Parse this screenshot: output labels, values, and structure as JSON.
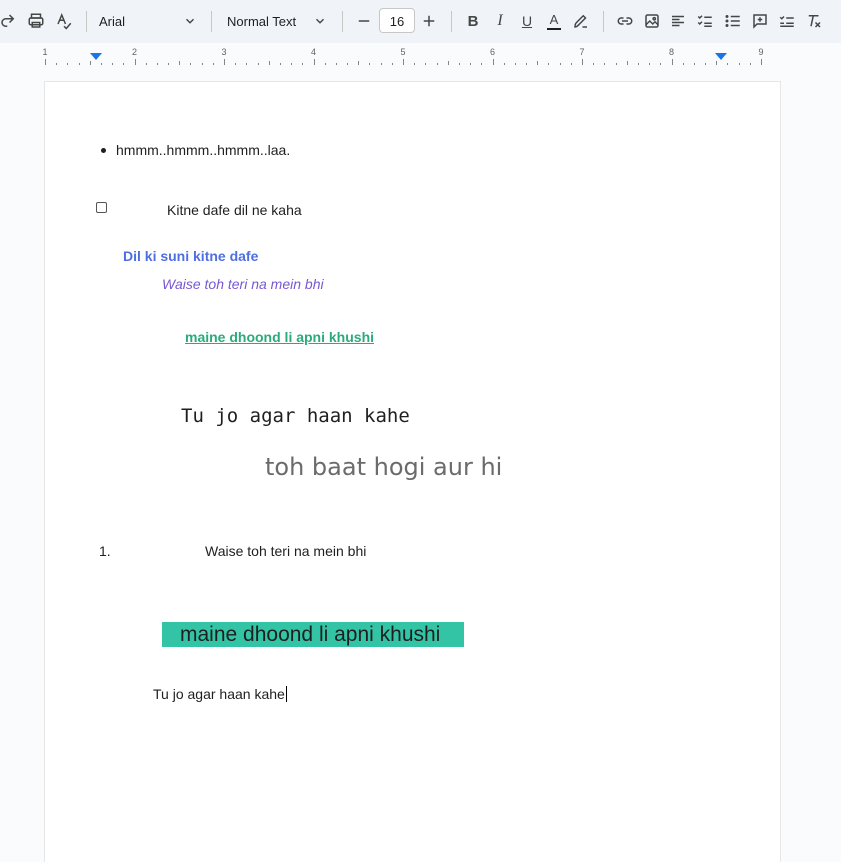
{
  "toolbar": {
    "font_family": "Arial",
    "paragraph_style": "Normal Text",
    "font_size": "16",
    "icons": [
      "redo-icon",
      "print-icon",
      "spellcheck-icon",
      "minus-icon",
      "plus-icon",
      "bold-icon",
      "italic-icon",
      "underline-icon",
      "text-color-icon",
      "highlight-icon",
      "link-icon",
      "image-icon",
      "align-icon",
      "checklist-icon",
      "bulleted-list-icon",
      "comment-icon",
      "checklist-menu-icon",
      "clear-formatting-icon"
    ],
    "bold_glyph": "B",
    "italic_glyph": "I",
    "underline_glyph": "U",
    "text_color_glyph": "A"
  },
  "ruler": {
    "numbers": [
      "1",
      "2",
      "3",
      "4",
      "5",
      "6",
      "7",
      "8",
      "9"
    ]
  },
  "document": {
    "bullet_item": "hmmm..hmmm..hmmm..laa.",
    "checkbox_item": "Kitne dafe dil ne kaha",
    "line_blue_bold": "Dil ki suni kitne dafe",
    "line_purple_italic": "Waise toh teri na mein bhi",
    "line_green_underline": "maine dhoond li apni khushi",
    "line_mono": "Tu jo agar haan kahe",
    "line_gray_comic": "toh baat hogi aur hi",
    "numbered_marker": "1.",
    "numbered_item": "Waise toh teri na mein bhi",
    "highlighted_line": "maine dhoond li apni khushi",
    "last_line": "Tu jo agar haan kahe"
  },
  "colors": {
    "blue_text": "#4f6fe0",
    "purple_text": "#7a57d1",
    "green_text": "#2bab7c",
    "gray_text": "#6b6b6b",
    "highlight": "#33c4a6",
    "ruler_marker": "#1a73e8"
  }
}
